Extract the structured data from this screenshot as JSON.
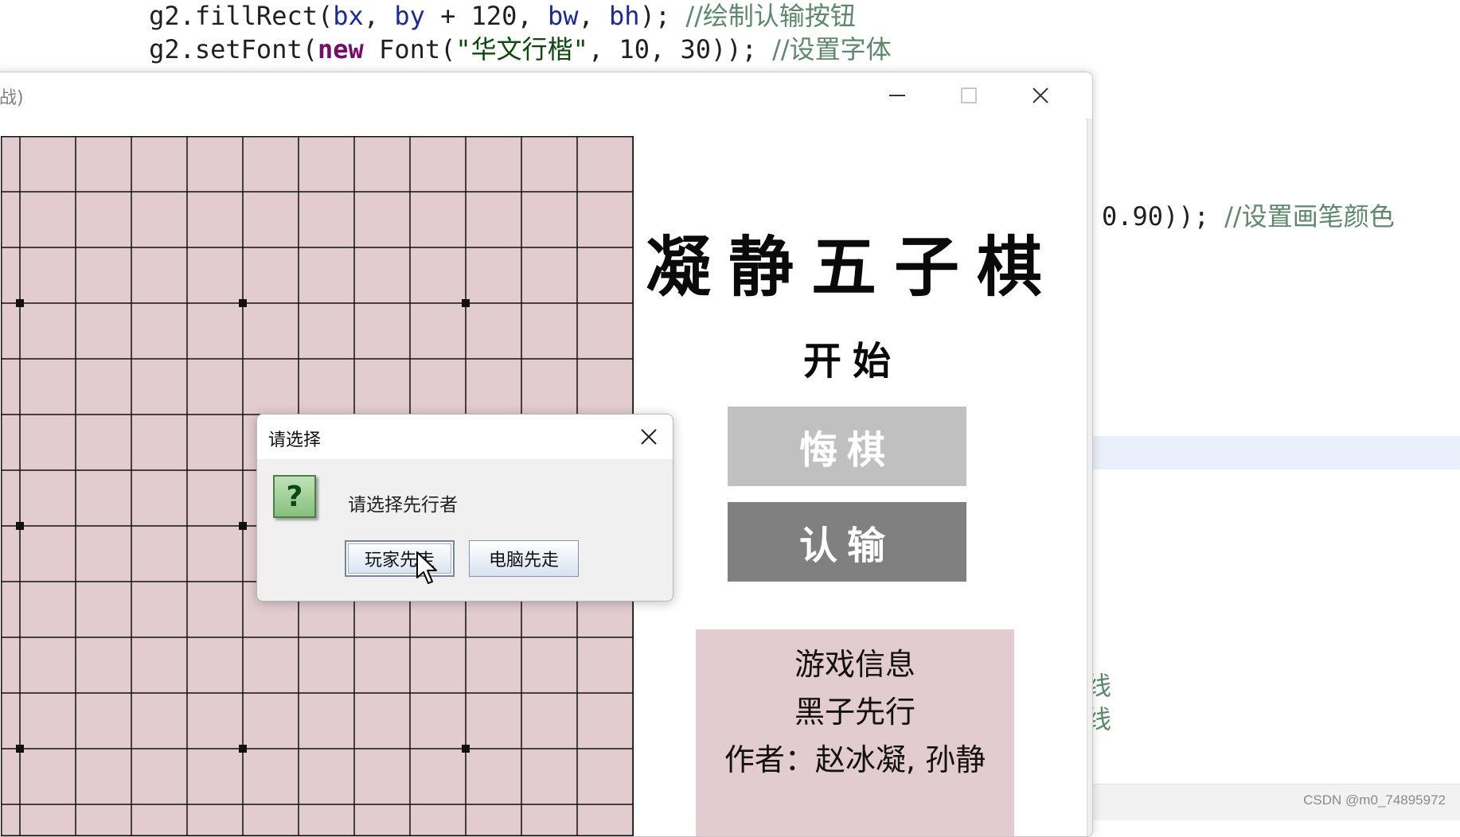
{
  "code_editor": {
    "line1": {
      "indent": "    ",
      "call": "g2.fillRect(",
      "arg1": "bx",
      "sep1": ", ",
      "arg2": "by",
      "sep2": " + 120, ",
      "arg3": "bw",
      "sep3": ", ",
      "arg4": "bh",
      "end": ");",
      "comment": "//绘制认输按钮"
    },
    "line2": {
      "indent": "    ",
      "call": "g2.setFont(",
      "kw": "new",
      "font_ctor": " Font(",
      "str": "\"华文行楷\"",
      "args": ", 10, 30));",
      "comment": "//设置字体"
    },
    "line3": {
      "code": "0.90));",
      "comment": "//设置画笔颜色"
    },
    "fragment1": "线",
    "fragment2": "线"
  },
  "window": {
    "title": "战)",
    "minimize_icon": "minimize-icon",
    "maximize_icon": "maximize-icon",
    "close_icon": "close-icon"
  },
  "board": {
    "background": "#e3ccd0",
    "line_color": "#111111"
  },
  "side_panel": {
    "game_title": "凝静五子棋",
    "start_label": "开始",
    "undo_button": "悔棋",
    "resign_button": "认输",
    "info_title": "游戏信息",
    "info_turn": "黑子先行",
    "info_author": "作者：赵冰凝, 孙静"
  },
  "dialog": {
    "title": "请选择",
    "icon": "question-icon",
    "icon_glyph": "?",
    "message": "请选择先行者",
    "player_first_button": "玩家先走",
    "computer_first_button": "电脑先走"
  },
  "watermark": "CSDN @m0_74895972"
}
